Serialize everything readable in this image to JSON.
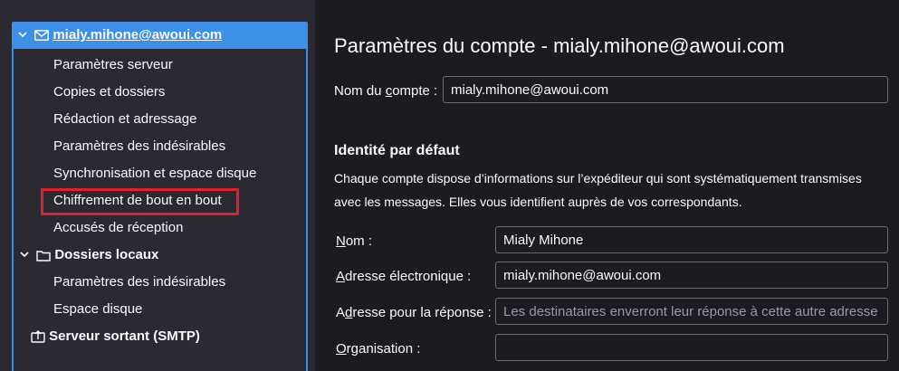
{
  "sidebar": {
    "account": {
      "label": "mialy.mihone@awoui.com"
    },
    "account_items": [
      {
        "label": "Paramètres serveur"
      },
      {
        "label": "Copies et dossiers"
      },
      {
        "label": "Rédaction et adressage"
      },
      {
        "label": "Paramètres des indésirables"
      },
      {
        "label": "Synchronisation et espace disque"
      },
      {
        "label": "Chiffrement de bout en bout"
      },
      {
        "label": "Accusés de réception"
      }
    ],
    "local_folders": {
      "label": "Dossiers locaux"
    },
    "local_items": [
      {
        "label": "Paramètres des indésirables"
      },
      {
        "label": "Espace disque"
      }
    ],
    "smtp": {
      "label": "Serveur sortant (SMTP)"
    }
  },
  "main": {
    "title": "Paramètres du compte - mialy.mihone@awoui.com",
    "account_name_label_pre": "Nom du ",
    "account_name_label_u": "c",
    "account_name_label_post": "ompte :",
    "account_name_value": "mialy.mihone@awoui.com",
    "identity_heading": "Identité par défaut",
    "identity_desc": "Chaque compte dispose d’informations sur l’expéditeur qui sont systématiquement transmises avec les messages. Elles vous identifient auprès de vos correspondants.",
    "name_label_u": "N",
    "name_label_post": "om :",
    "name_value": "Mialy Mihone",
    "email_label_u": "A",
    "email_label_post": "dresse électronique :",
    "email_value": "mialy.mihone@awoui.com",
    "reply_label_pre": "A",
    "reply_label_u": "d",
    "reply_label_post": "resse pour la réponse :",
    "reply_placeholder": "Les destinataires enverront leur réponse à cette autre adresse",
    "org_label_u": "O",
    "org_label_post": "rganisation :",
    "org_value": ""
  },
  "colors": {
    "accent": "#3d8fe8",
    "highlight": "#e0202a",
    "sidebar_bg": "#2b2a33",
    "main_bg": "#1c1b22"
  }
}
